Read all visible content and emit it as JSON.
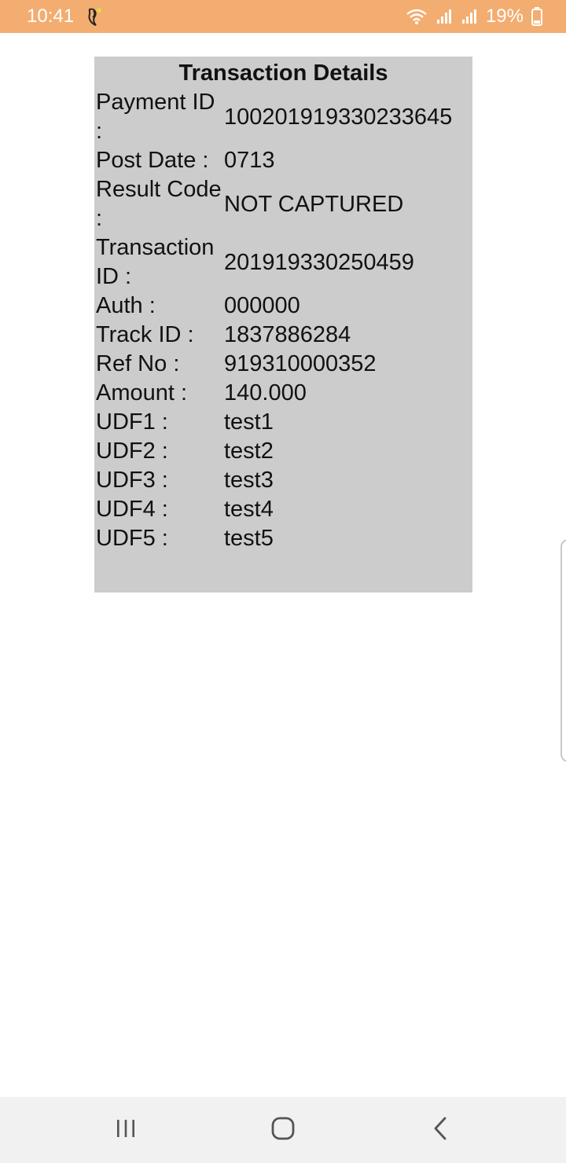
{
  "status_bar": {
    "time": "10:41",
    "battery_percent": "19%",
    "app_icon": "notification-icon",
    "colors": {
      "background": "#f3ad70",
      "text": "#ffffff"
    }
  },
  "card": {
    "title": "Transaction Details",
    "background": "#cccccc",
    "rows": [
      {
        "label": "Payment ID :",
        "value": "100201919330233645"
      },
      {
        "label": "Post Date :",
        "value": "0713"
      },
      {
        "label": "Result Code :",
        "value": "NOT CAPTURED"
      },
      {
        "label": "Transaction ID :",
        "value": "201919330250459"
      },
      {
        "label": "Auth :",
        "value": "000000"
      },
      {
        "label": "Track ID :",
        "value": "1837886284"
      },
      {
        "label": "Ref No :",
        "value": "919310000352"
      },
      {
        "label": "Amount :",
        "value": "140.000"
      },
      {
        "label": "UDF1 :",
        "value": "test1"
      },
      {
        "label": "UDF2 :",
        "value": "test2"
      },
      {
        "label": "UDF3 :",
        "value": "test3"
      },
      {
        "label": "UDF4 :",
        "value": "test4"
      },
      {
        "label": "UDF5 :",
        "value": "test5"
      }
    ]
  },
  "nav_bar": {
    "icons": [
      "recent-apps-icon",
      "home-icon",
      "back-icon"
    ]
  }
}
